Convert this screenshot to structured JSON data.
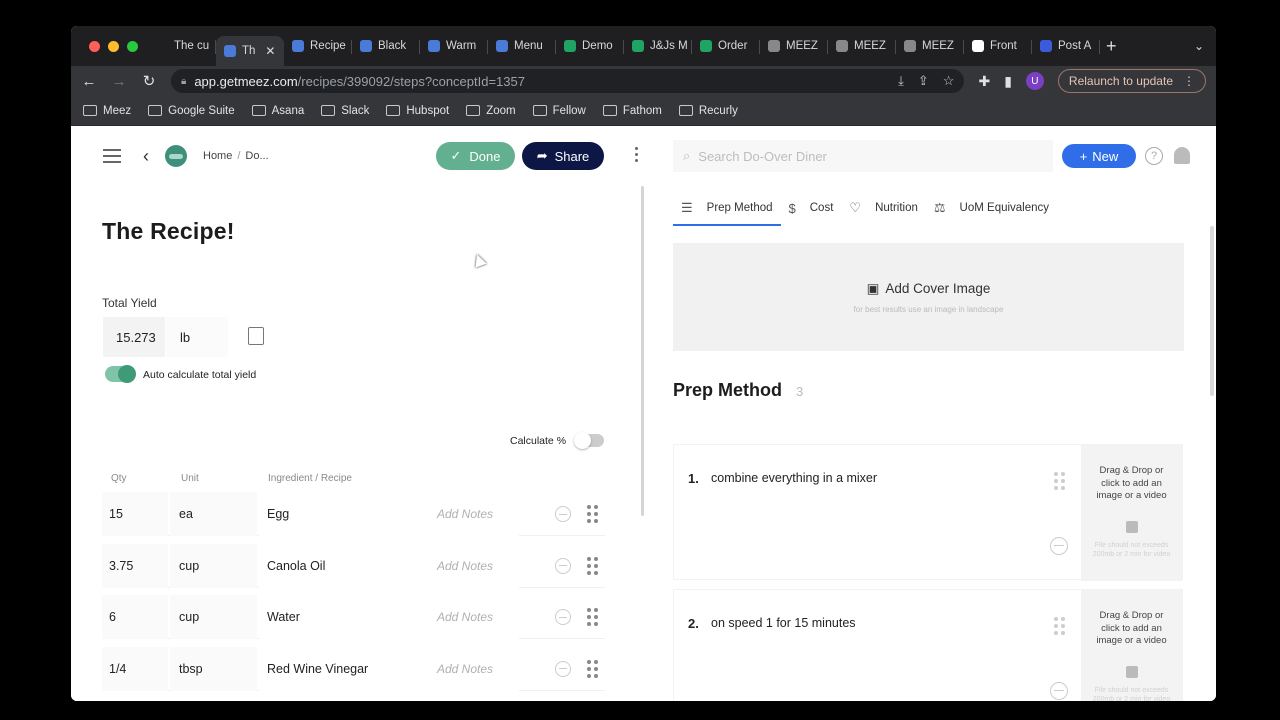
{
  "browser": {
    "tabs": [
      {
        "label": "The cu",
        "color": "#1f1f21",
        "active": false
      },
      {
        "label": "Th",
        "color": "#4a7bd9",
        "active": true
      },
      {
        "label": "Recipe",
        "color": "#4a7bd9",
        "active": false
      },
      {
        "label": "Black",
        "color": "#4a7bd9",
        "active": false
      },
      {
        "label": "Warm",
        "color": "#4a7bd9",
        "active": false
      },
      {
        "label": "Menu",
        "color": "#4a7bd9",
        "active": false
      },
      {
        "label": "Demo",
        "color": "#1fa463",
        "active": false
      },
      {
        "label": "J&Js M",
        "color": "#1fa463",
        "active": false
      },
      {
        "label": "Order",
        "color": "#1fa463",
        "active": false
      },
      {
        "label": "MEEZ",
        "color": "#888888",
        "active": false
      },
      {
        "label": "MEEZ",
        "color": "#888888",
        "active": false
      },
      {
        "label": "MEEZ",
        "color": "#888888",
        "active": false
      },
      {
        "label": "Front",
        "color": "#ffffff",
        "active": false
      },
      {
        "label": "Post A",
        "color": "#3b5bdb",
        "active": false
      }
    ],
    "url_host": "app.getmeez.com",
    "url_path": "/recipes/399092/steps?conceptId=1357",
    "profile_initial": "U",
    "relaunch_label": "Relaunch to update",
    "bookmarks": [
      "Meez",
      "Google Suite",
      "Asana",
      "Slack",
      "Hubspot",
      "Zoom",
      "Fellow",
      "Fathom",
      "Recurly"
    ]
  },
  "header": {
    "breadcrumb_home": "Home",
    "breadcrumb_sep": "/",
    "breadcrumb_current": "Do...",
    "done_label": "Done",
    "share_label": "Share"
  },
  "recipe": {
    "title": "The Recipe!",
    "total_yield_label": "Total Yield",
    "yield_value": "15.273",
    "yield_unit": "lb",
    "auto_calc_label": "Auto calculate total yield",
    "calc_percent_label": "Calculate %",
    "columns": {
      "qty": "Qty",
      "unit": "Unit",
      "ingredient": "Ingredient / Recipe"
    },
    "add_notes": "Add Notes",
    "ingredients": [
      {
        "qty": "15",
        "unit": "ea",
        "name": "Egg"
      },
      {
        "qty": "3.75",
        "unit": "cup",
        "name": "Canola Oil"
      },
      {
        "qty": "6",
        "unit": "cup",
        "name": "Water"
      },
      {
        "qty": "1/4",
        "unit": "tbsp",
        "name": "Red Wine Vinegar"
      }
    ]
  },
  "right": {
    "search_placeholder": "Search Do-Over Diner",
    "new_label": "New",
    "tabs": [
      {
        "label": "Prep Method",
        "icon": "list-icon",
        "active": true
      },
      {
        "label": "Cost",
        "icon": "dollar-icon",
        "active": false
      },
      {
        "label": "Nutrition",
        "icon": "heart-icon",
        "active": false
      },
      {
        "label": "UoM Equivalency",
        "icon": "scale-icon",
        "active": false
      }
    ],
    "cover_label": "Add Cover Image",
    "cover_hint": "for best results use an image in landscape",
    "prep_title": "Prep Method",
    "prep_count": "3",
    "media_label": "Drag & Drop or click to add an image or a video",
    "media_hint": "File should not exceeds 200mb or 2 min for video",
    "steps": [
      {
        "num": "1.",
        "text": "combine everything in a mixer"
      },
      {
        "num": "2.",
        "text": "on speed 1 for 15 minutes"
      }
    ]
  },
  "colors": {
    "accent": "#2f6ee8",
    "done": "#62b08f",
    "share": "#0d1745"
  }
}
